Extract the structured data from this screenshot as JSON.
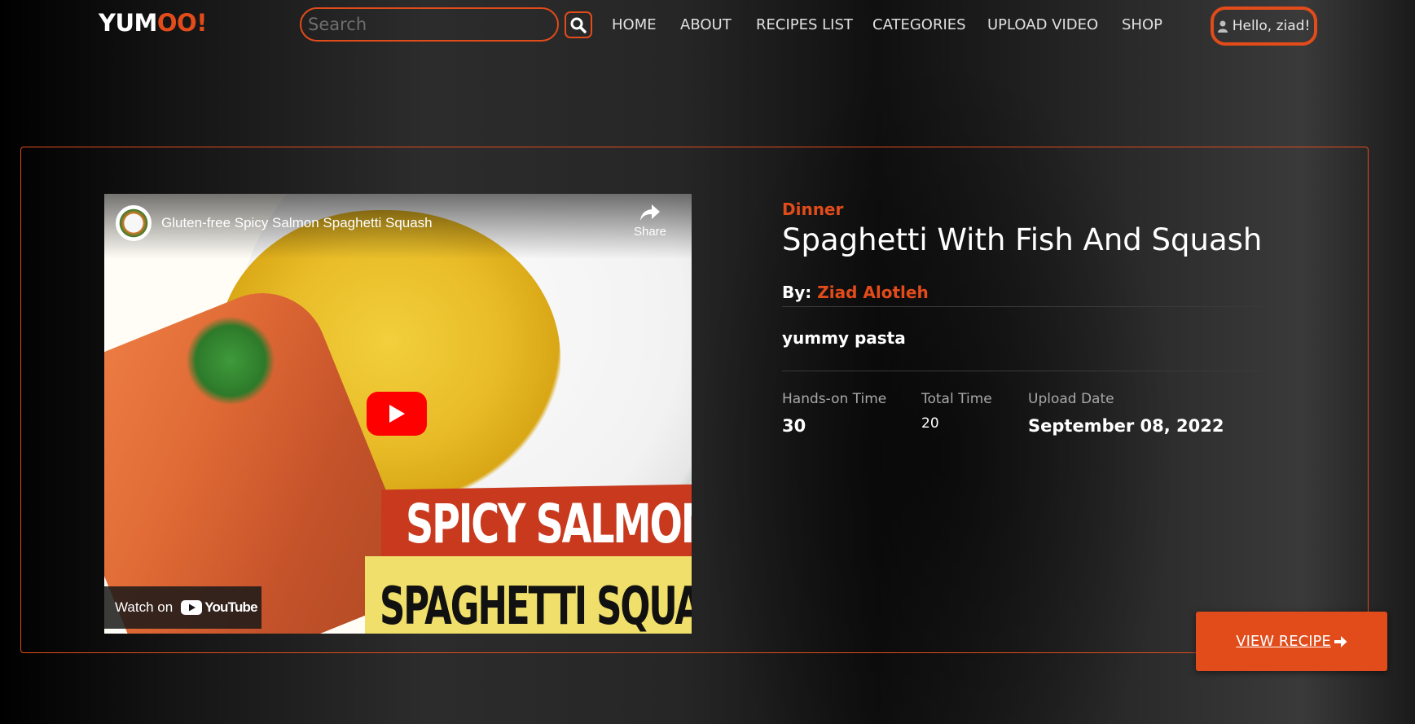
{
  "header": {
    "logo_part1": "YUM",
    "logo_part2": "OO!",
    "search_placeholder": "Search",
    "nav": [
      {
        "label": "HOME"
      },
      {
        "label": "ABOUT"
      },
      {
        "label": "RECIPES LIST"
      },
      {
        "label": "CATEGORIES"
      },
      {
        "label": "UPLOAD VIDEO"
      },
      {
        "label": "SHOP"
      }
    ],
    "user_greeting": "Hello, ziad!"
  },
  "video": {
    "title": "Gluten-free Spicy Salmon Spaghetti Squash",
    "share_label": "Share",
    "watch_on_label": "Watch on",
    "youtube_label": "YouTube",
    "thumb_text_1": "SPICY SALMON",
    "thumb_text_2": "SPAGHETTI SQUASH"
  },
  "recipe": {
    "category": "Dinner",
    "title": "Spaghetti With Fish And Squash",
    "by_label": "By:",
    "author": "Ziad Alotleh",
    "description": "yummy pasta",
    "stats": [
      {
        "label": "Hands-on Time",
        "value": "30"
      },
      {
        "label": "Total Time",
        "value": "20"
      },
      {
        "label": "Upload Date",
        "value": "September 08, 2022"
      }
    ],
    "view_button_label": "VIEW RECIPE"
  },
  "colors": {
    "accent": "#e24b1a",
    "youtube_red": "#ff0000"
  },
  "icons": {
    "search": "search-icon",
    "user": "user-icon",
    "share": "share-icon",
    "play": "play-icon",
    "arrow": "arrow-right-icon"
  }
}
